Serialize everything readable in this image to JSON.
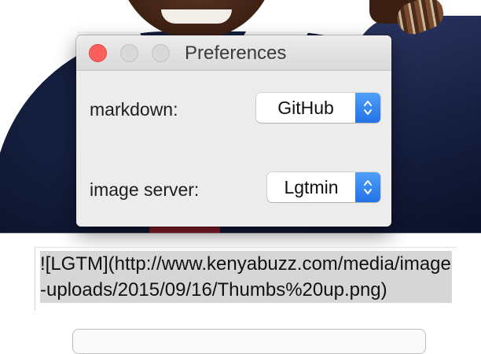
{
  "window": {
    "title": "Preferences"
  },
  "preferences": {
    "markdown_label": "markdown:",
    "markdown_value": "GitHub",
    "image_server_label": "image server:",
    "image_server_value": "Lgtmin"
  },
  "output": {
    "text": "![LGTM](http://www.kenyabuzz.com/media/image-uploads/2015/09/16/Thumbs%20up.png)"
  },
  "colors": {
    "close_button": "#fc605c",
    "popup_accent": "#2f7ff0",
    "selection": "#d6d6d6"
  }
}
